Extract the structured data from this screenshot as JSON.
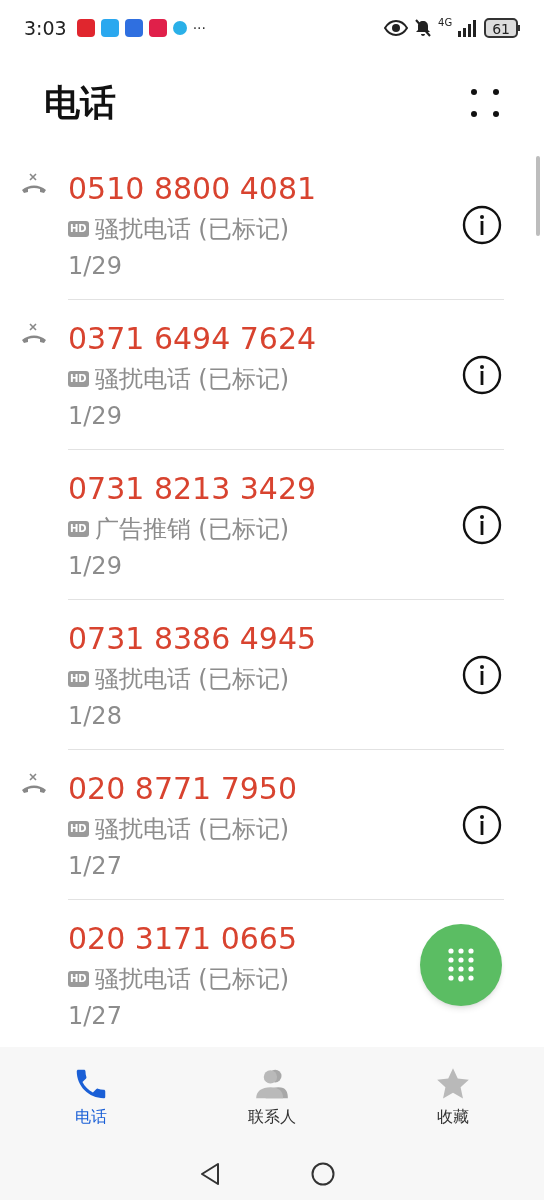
{
  "status_bar": {
    "time": "3:03",
    "more": "···",
    "network": "4G",
    "battery": "61"
  },
  "header": {
    "title": "电话"
  },
  "calls": [
    {
      "number": "0510 8800 4081",
      "badge": "HD",
      "label": "骚扰电话 (已标记)",
      "date": "1/29",
      "rejected": true
    },
    {
      "number": "0371 6494 7624",
      "badge": "HD",
      "label": "骚扰电话 (已标记)",
      "date": "1/29",
      "rejected": true
    },
    {
      "number": "0731 8213 3429",
      "badge": "HD",
      "label": "广告推销 (已标记)",
      "date": "1/29",
      "rejected": false
    },
    {
      "number": "0731 8386 4945",
      "badge": "HD",
      "label": "骚扰电话 (已标记)",
      "date": "1/28",
      "rejected": false
    },
    {
      "number": "020 8771 7950",
      "badge": "HD",
      "label": "骚扰电话 (已标记)",
      "date": "1/27",
      "rejected": true
    },
    {
      "number": "020 3171 0665",
      "badge": "HD",
      "label": "骚扰电话 (已标记)",
      "date": "1/27",
      "rejected": false
    }
  ],
  "tabs": [
    {
      "label": "电话",
      "kind": "phone",
      "selected": true
    },
    {
      "label": "联系人",
      "kind": "contacts",
      "selected": false
    },
    {
      "label": "收藏",
      "kind": "favorites",
      "selected": false
    }
  ]
}
